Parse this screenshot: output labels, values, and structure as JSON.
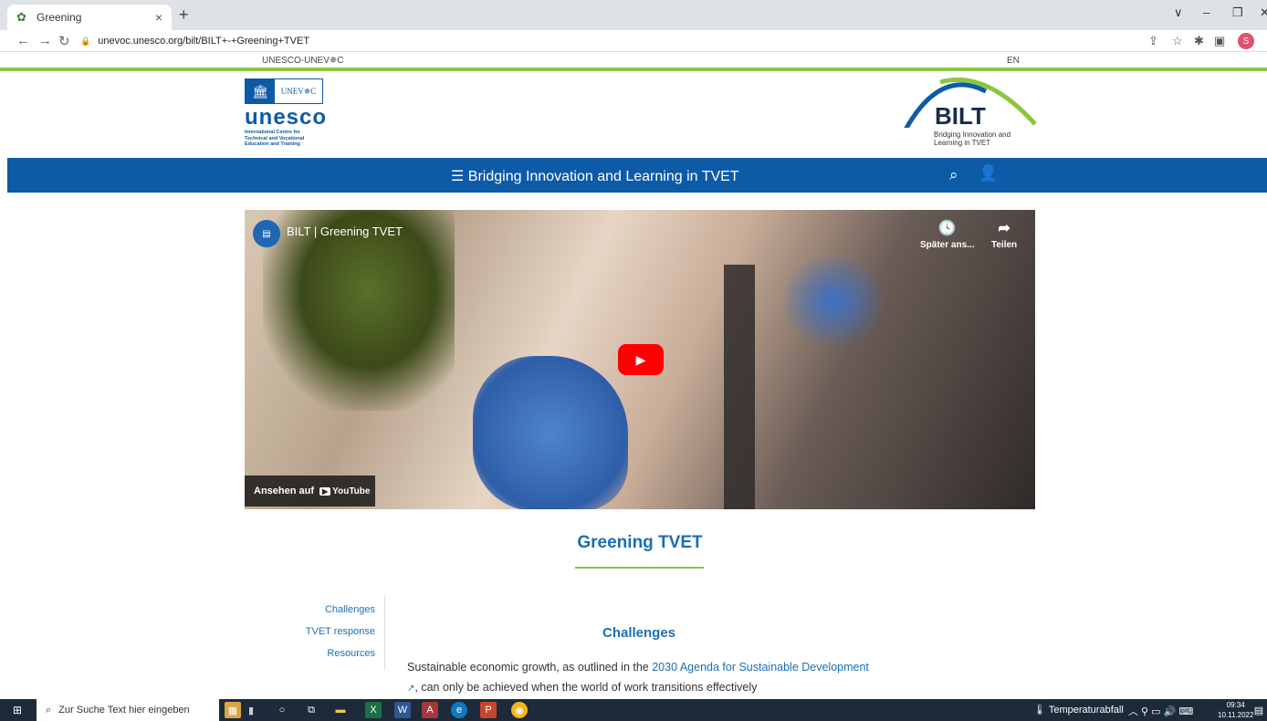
{
  "browser": {
    "tab_title": "Greening",
    "tab_close": "×",
    "new_tab": "+",
    "url": "unevoc.unesco.org/bilt/BILT+-+Greening+TVET",
    "profile_initial": "S",
    "window_controls": [
      "∨",
      "–",
      "❐",
      "✕"
    ]
  },
  "site": {
    "brand": "UNESCO-UNEV✵C",
    "language": "EN",
    "unesco_logo": {
      "box_label": "UNEV✵C",
      "word": "unesco",
      "subtitle": [
        "International Centre for",
        "Technical and Vocational",
        "Education and Training"
      ]
    },
    "bilt_logo": {
      "word": "BILT",
      "subtitle": [
        "Bridging Innovation and",
        "Learning in TVET"
      ]
    },
    "nav": {
      "menu_label": "☰ Bridging Innovation and Learning in TVET",
      "search_icon": "search-icon",
      "user_icon": "user-icon"
    }
  },
  "video": {
    "title": "BILT | Greening TVET",
    "watch_later": "Später ans...",
    "share": "Teilen",
    "watch_on": "Ansehen auf",
    "youtube": "YouTube"
  },
  "content": {
    "page_title": "Greening TVET",
    "side_nav": [
      "Challenges",
      "TVET response",
      "Resources"
    ],
    "section_heading": "Challenges",
    "paragraph_start": "Sustainable economic growth, as outlined in the ",
    "paragraph_link": "2030 Agenda for Sustainable Development",
    "paragraph_end": ", can only be achieved when the world of work transitions effectively"
  },
  "taskbar": {
    "search_placeholder": "Zur Suche Text hier eingeben",
    "weather": "Temperaturabfall",
    "time": "09:34",
    "date": "10.11.2022"
  },
  "colors": {
    "unesco_blue": "#0d5aa7",
    "link_blue": "#1a6fb5",
    "green_accent": "#8cc63f",
    "youtube_red": "#ff0000"
  }
}
